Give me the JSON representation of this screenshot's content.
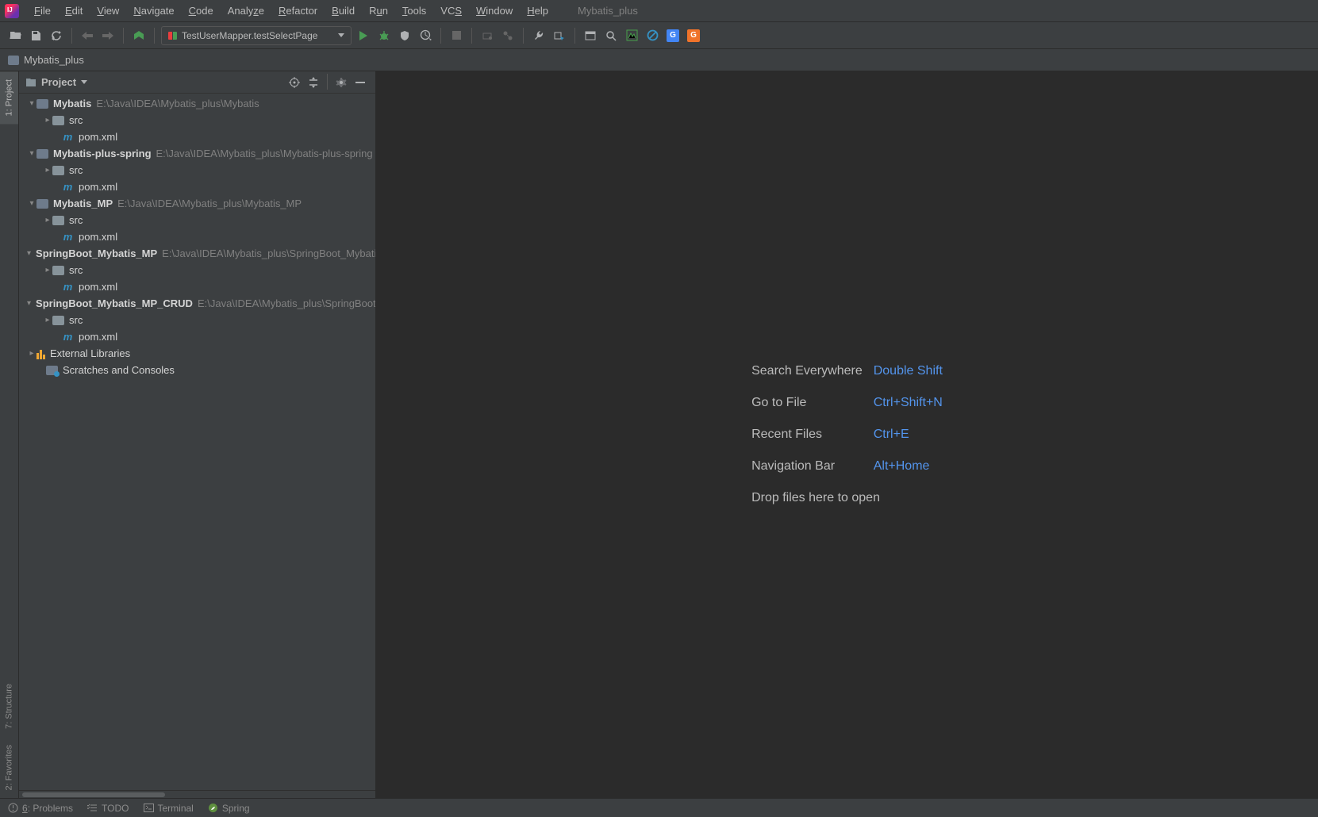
{
  "window_title": "Mybatis_plus",
  "menu": [
    "File",
    "Edit",
    "View",
    "Navigate",
    "Code",
    "Analyze",
    "Refactor",
    "Build",
    "Run",
    "Tools",
    "VCS",
    "Window",
    "Help"
  ],
  "toolbar": {
    "run_config_label": "TestUserMapper.testSelectPage"
  },
  "breadcrumb": {
    "project": "Mybatis_plus"
  },
  "project_panel": {
    "title": "Project"
  },
  "tree": {
    "modules": [
      {
        "name": "Mybatis",
        "path": "E:\\Java\\IDEA\\Mybatis_plus\\Mybatis",
        "src": "src",
        "pom": "pom.xml"
      },
      {
        "name": "Mybatis-plus-spring",
        "path": "E:\\Java\\IDEA\\Mybatis_plus\\Mybatis-plus-spring",
        "src": "src",
        "pom": "pom.xml"
      },
      {
        "name": "Mybatis_MP",
        "path": "E:\\Java\\IDEA\\Mybatis_plus\\Mybatis_MP",
        "src": "src",
        "pom": "pom.xml"
      },
      {
        "name": "SpringBoot_Mybatis_MP",
        "path": "E:\\Java\\IDEA\\Mybatis_plus\\SpringBoot_Mybatis_MP",
        "src": "src",
        "pom": "pom.xml"
      },
      {
        "name": "SpringBoot_Mybatis_MP_CRUD",
        "path": "E:\\Java\\IDEA\\Mybatis_plus\\SpringBoot_Mybatis_MP_CRUD",
        "src": "src",
        "pom": "pom.xml"
      }
    ],
    "external_libs": "External Libraries",
    "scratches": "Scratches and Consoles"
  },
  "left_tabs": {
    "project": "1: Project",
    "structure": "7: Structure",
    "favorites": "2: Favorites"
  },
  "welcome": {
    "r1_label": "Search Everywhere",
    "r1_key": "Double Shift",
    "r2_label": "Go to File",
    "r2_key": "Ctrl+Shift+N",
    "r3_label": "Recent Files",
    "r3_key": "Ctrl+E",
    "r4_label": "Navigation Bar",
    "r4_key": "Alt+Home",
    "r5_label": "Drop files here to open"
  },
  "bottom": {
    "problems": "6: Problems",
    "todo": "TODO",
    "terminal": "Terminal",
    "spring": "Spring"
  }
}
